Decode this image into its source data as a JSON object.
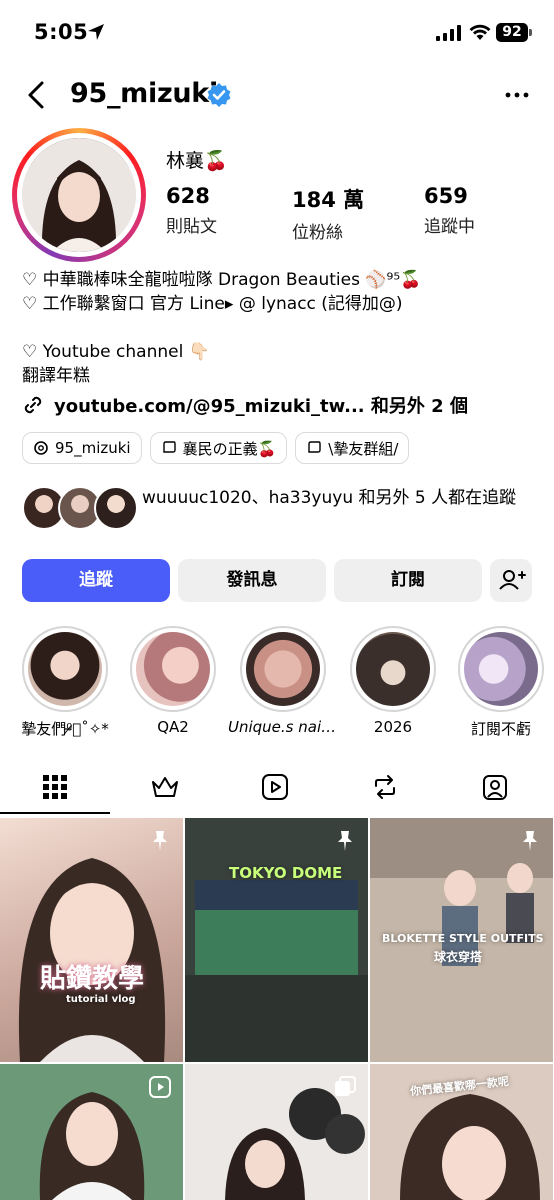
{
  "status_bar": {
    "time": "5:05",
    "battery": "92"
  },
  "header": {
    "username": "95_mizuki"
  },
  "profile": {
    "display_name": "林襄🍒",
    "stats": [
      {
        "value": "628",
        "label": "則貼文"
      },
      {
        "value": "184 萬",
        "label": "位粉絲"
      },
      {
        "value": "659",
        "label": "追蹤中"
      }
    ],
    "bio_lines": [
      "♡ 中華職棒味全龍啦啦隊 Dragon Beauties ⚾️⁹⁵🍒",
      "♡ 工作聯繫窗口 官方 Line▸ @ lynacc (記得加@)",
      "",
      "♡ Youtube channel 👇🏻",
      "翻譯年糕"
    ],
    "link": "youtube.com/@95_mizuki_tw... 和另外 2 個",
    "chips": [
      {
        "icon": "threads-icon",
        "label": "95_mizuki"
      },
      {
        "icon": "channel-icon",
        "label": "襄民の正義🍒"
      },
      {
        "icon": "channel-icon",
        "label": "\\摯友群組/"
      }
    ],
    "followed_by": "wuuuuc1020、ha33yuyu 和另外 5 人都在追蹤"
  },
  "actions": {
    "follow": "追蹤",
    "message": "發訊息",
    "subscribe": "訂閱"
  },
  "highlights": [
    {
      "label": "摯友們⁰̷̴͐˚✧*",
      "color": "#c9a79a"
    },
    {
      "label": "QA2",
      "color": "#d89ca0"
    },
    {
      "label": "Unique.s nail...",
      "color": "#d8b2a7"
    },
    {
      "label": "2026",
      "color": "#6d5a4f"
    },
    {
      "label": "訂閱不虧",
      "color": "#b7a3c9"
    }
  ],
  "tabs": [
    "grid-icon",
    "crown-icon",
    "reels-icon",
    "reposts-icon",
    "tagged-icon"
  ],
  "posts": [
    {
      "overlay": "貼鑽教學",
      "sub": "tutorial vlog",
      "badge": "pin-icon"
    },
    {
      "overlay": "TOKYO DOME",
      "badge": "pin-icon"
    },
    {
      "overlay": "BLOKETTE STYLE OUTFITS",
      "sub": "球衣穿搭",
      "badge": "pin-icon"
    },
    {
      "overlay": "",
      "badge": "reel-icon"
    },
    {
      "overlay": "",
      "badge": "carousel-icon"
    },
    {
      "overlay": "你們最喜歡哪一款呢",
      "badge": ""
    }
  ],
  "colors": {
    "accent": "#4a5df9",
    "verified": "#3897f0"
  }
}
